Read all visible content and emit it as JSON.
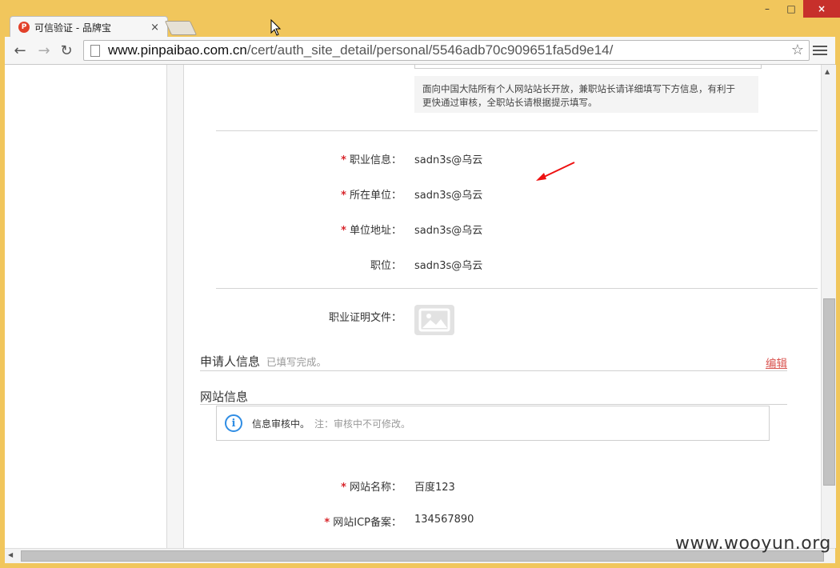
{
  "browser": {
    "tab_title": "可信验证 - 品牌宝",
    "favicon_letter": "P",
    "tab_close": "×",
    "url_host": "www.pinpaibao.com.cn",
    "url_path": "/cert/auth_site_detail/personal/5546adb70c909651fa5d9e14/",
    "back": "←",
    "forward": "→",
    "reload": "↻",
    "star": "☆",
    "win_min": "–",
    "win_max": "□",
    "win_close": "×"
  },
  "notice": {
    "line1": "面向中国大陆所有个人网站站长开放，兼职站长请详细填写下方信息，有利于",
    "line2": "更快通过审核，全职站长请根据提示填写。"
  },
  "job": {
    "required_mark": "*",
    "fields": [
      {
        "label": "职业信息：",
        "value": "sadn3s@乌云",
        "required": true
      },
      {
        "label": "所在单位：",
        "value": "sadn3s@乌云",
        "required": true
      },
      {
        "label": "单位地址：",
        "value": "sadn3s@乌云",
        "required": true
      },
      {
        "label": "职位：",
        "value": "sadn3s@乌云",
        "required": false
      }
    ],
    "cert_label": "职业证明文件："
  },
  "applicant": {
    "title": "申请人信息",
    "status": "已填写完成。",
    "edit": "编辑"
  },
  "site": {
    "title": "网站信息",
    "info_icon": "i",
    "info_text": "信息审核中。",
    "info_note": "注：审核中不可修改。",
    "fields": [
      {
        "label": "网站名称：",
        "value": "百度123"
      },
      {
        "label": "网站ICP备案：",
        "value": "134567890"
      }
    ]
  },
  "watermark": "www.wooyun.org",
  "colors": {
    "required": "#d8262c",
    "edit_link": "#d9534f",
    "info_blue": "#2f8de4",
    "close_red": "#c7302b",
    "frame": "#f1c65c"
  }
}
